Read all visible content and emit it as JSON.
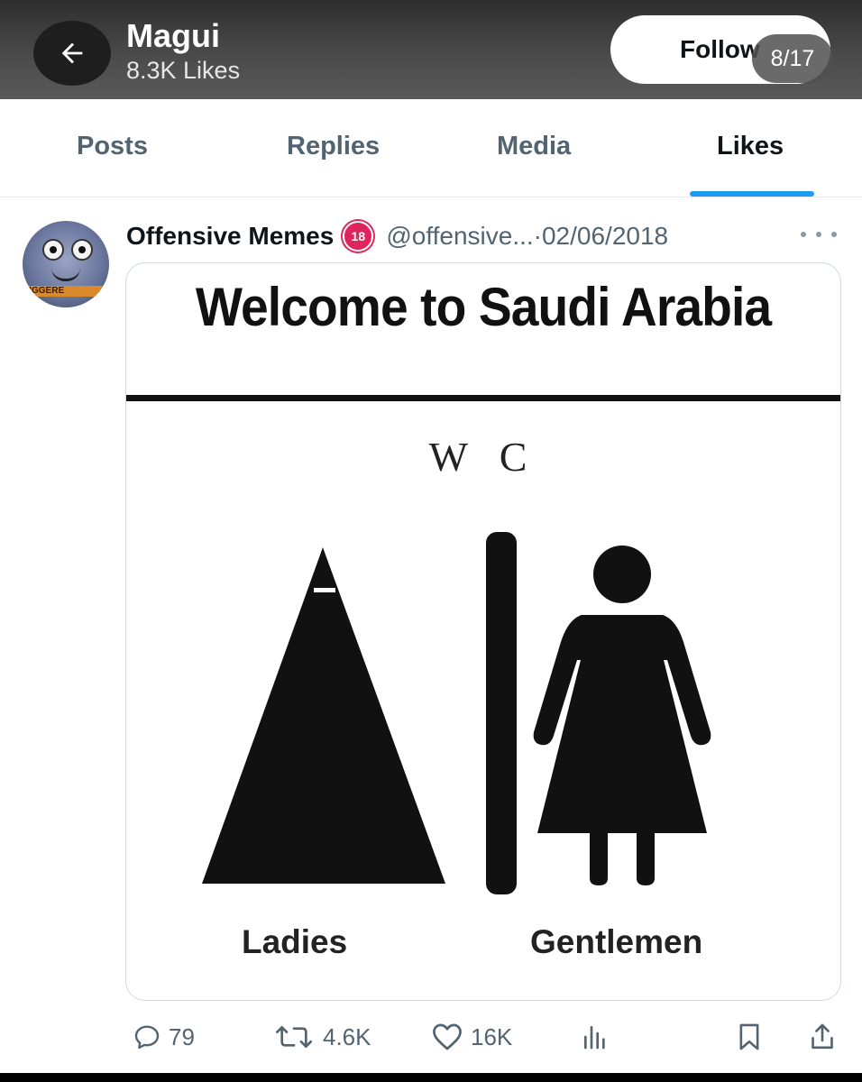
{
  "header": {
    "title": "Magui",
    "subtitle": "8.3K Likes",
    "follow_label": "Follow",
    "page_counter": "8/17"
  },
  "tabs": [
    {
      "label": "Posts",
      "active": false
    },
    {
      "label": "Replies",
      "active": false
    },
    {
      "label": "Media",
      "active": false
    },
    {
      "label": "Likes",
      "active": true
    }
  ],
  "tweet": {
    "author": "Offensive Memes",
    "badge": "18",
    "handle": "@offensive...",
    "separator": " · ",
    "date": "02/06/2018",
    "avatar_text": "RIGGERE",
    "image": {
      "title": "Welcome to Saudi Arabia",
      "wc": "W C",
      "left_label": "Ladies",
      "right_label": "Gentlemen"
    },
    "stats": {
      "replies": "79",
      "reposts": "4.6K",
      "likes": "16K"
    }
  },
  "colors": {
    "accent": "#1d9bf0",
    "muted_text": "#536471",
    "badge": "#e0245e"
  },
  "icons": [
    "arrow-left-icon",
    "more-horizontal-icon",
    "reply-icon",
    "repost-icon",
    "heart-icon",
    "views-icon",
    "bookmark-icon",
    "share-icon"
  ]
}
